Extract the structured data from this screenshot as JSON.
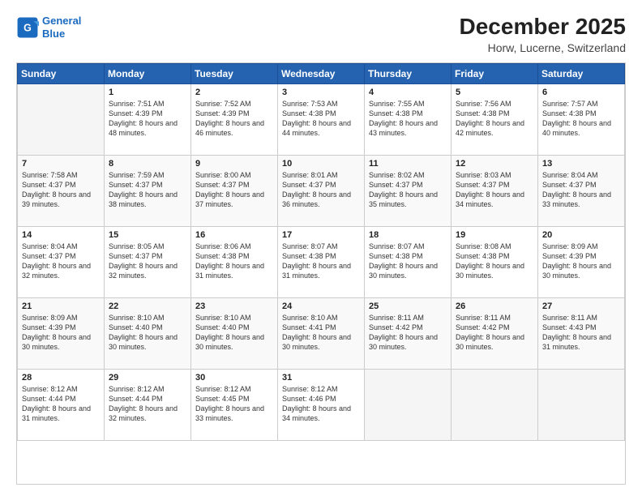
{
  "header": {
    "logo_line1": "General",
    "logo_line2": "Blue",
    "title": "December 2025",
    "subtitle": "Horw, Lucerne, Switzerland"
  },
  "weekdays": [
    "Sunday",
    "Monday",
    "Tuesday",
    "Wednesday",
    "Thursday",
    "Friday",
    "Saturday"
  ],
  "weeks": [
    [
      {
        "day": "",
        "sunrise": "",
        "sunset": "",
        "daylight": ""
      },
      {
        "day": "1",
        "sunrise": "Sunrise: 7:51 AM",
        "sunset": "Sunset: 4:39 PM",
        "daylight": "Daylight: 8 hours and 48 minutes."
      },
      {
        "day": "2",
        "sunrise": "Sunrise: 7:52 AM",
        "sunset": "Sunset: 4:39 PM",
        "daylight": "Daylight: 8 hours and 46 minutes."
      },
      {
        "day": "3",
        "sunrise": "Sunrise: 7:53 AM",
        "sunset": "Sunset: 4:38 PM",
        "daylight": "Daylight: 8 hours and 44 minutes."
      },
      {
        "day": "4",
        "sunrise": "Sunrise: 7:55 AM",
        "sunset": "Sunset: 4:38 PM",
        "daylight": "Daylight: 8 hours and 43 minutes."
      },
      {
        "day": "5",
        "sunrise": "Sunrise: 7:56 AM",
        "sunset": "Sunset: 4:38 PM",
        "daylight": "Daylight: 8 hours and 42 minutes."
      },
      {
        "day": "6",
        "sunrise": "Sunrise: 7:57 AM",
        "sunset": "Sunset: 4:38 PM",
        "daylight": "Daylight: 8 hours and 40 minutes."
      }
    ],
    [
      {
        "day": "7",
        "sunrise": "Sunrise: 7:58 AM",
        "sunset": "Sunset: 4:37 PM",
        "daylight": "Daylight: 8 hours and 39 minutes."
      },
      {
        "day": "8",
        "sunrise": "Sunrise: 7:59 AM",
        "sunset": "Sunset: 4:37 PM",
        "daylight": "Daylight: 8 hours and 38 minutes."
      },
      {
        "day": "9",
        "sunrise": "Sunrise: 8:00 AM",
        "sunset": "Sunset: 4:37 PM",
        "daylight": "Daylight: 8 hours and 37 minutes."
      },
      {
        "day": "10",
        "sunrise": "Sunrise: 8:01 AM",
        "sunset": "Sunset: 4:37 PM",
        "daylight": "Daylight: 8 hours and 36 minutes."
      },
      {
        "day": "11",
        "sunrise": "Sunrise: 8:02 AM",
        "sunset": "Sunset: 4:37 PM",
        "daylight": "Daylight: 8 hours and 35 minutes."
      },
      {
        "day": "12",
        "sunrise": "Sunrise: 8:03 AM",
        "sunset": "Sunset: 4:37 PM",
        "daylight": "Daylight: 8 hours and 34 minutes."
      },
      {
        "day": "13",
        "sunrise": "Sunrise: 8:04 AM",
        "sunset": "Sunset: 4:37 PM",
        "daylight": "Daylight: 8 hours and 33 minutes."
      }
    ],
    [
      {
        "day": "14",
        "sunrise": "Sunrise: 8:04 AM",
        "sunset": "Sunset: 4:37 PM",
        "daylight": "Daylight: 8 hours and 32 minutes."
      },
      {
        "day": "15",
        "sunrise": "Sunrise: 8:05 AM",
        "sunset": "Sunset: 4:37 PM",
        "daylight": "Daylight: 8 hours and 32 minutes."
      },
      {
        "day": "16",
        "sunrise": "Sunrise: 8:06 AM",
        "sunset": "Sunset: 4:38 PM",
        "daylight": "Daylight: 8 hours and 31 minutes."
      },
      {
        "day": "17",
        "sunrise": "Sunrise: 8:07 AM",
        "sunset": "Sunset: 4:38 PM",
        "daylight": "Daylight: 8 hours and 31 minutes."
      },
      {
        "day": "18",
        "sunrise": "Sunrise: 8:07 AM",
        "sunset": "Sunset: 4:38 PM",
        "daylight": "Daylight: 8 hours and 30 minutes."
      },
      {
        "day": "19",
        "sunrise": "Sunrise: 8:08 AM",
        "sunset": "Sunset: 4:38 PM",
        "daylight": "Daylight: 8 hours and 30 minutes."
      },
      {
        "day": "20",
        "sunrise": "Sunrise: 8:09 AM",
        "sunset": "Sunset: 4:39 PM",
        "daylight": "Daylight: 8 hours and 30 minutes."
      }
    ],
    [
      {
        "day": "21",
        "sunrise": "Sunrise: 8:09 AM",
        "sunset": "Sunset: 4:39 PM",
        "daylight": "Daylight: 8 hours and 30 minutes."
      },
      {
        "day": "22",
        "sunrise": "Sunrise: 8:10 AM",
        "sunset": "Sunset: 4:40 PM",
        "daylight": "Daylight: 8 hours and 30 minutes."
      },
      {
        "day": "23",
        "sunrise": "Sunrise: 8:10 AM",
        "sunset": "Sunset: 4:40 PM",
        "daylight": "Daylight: 8 hours and 30 minutes."
      },
      {
        "day": "24",
        "sunrise": "Sunrise: 8:10 AM",
        "sunset": "Sunset: 4:41 PM",
        "daylight": "Daylight: 8 hours and 30 minutes."
      },
      {
        "day": "25",
        "sunrise": "Sunrise: 8:11 AM",
        "sunset": "Sunset: 4:42 PM",
        "daylight": "Daylight: 8 hours and 30 minutes."
      },
      {
        "day": "26",
        "sunrise": "Sunrise: 8:11 AM",
        "sunset": "Sunset: 4:42 PM",
        "daylight": "Daylight: 8 hours and 30 minutes."
      },
      {
        "day": "27",
        "sunrise": "Sunrise: 8:11 AM",
        "sunset": "Sunset: 4:43 PM",
        "daylight": "Daylight: 8 hours and 31 minutes."
      }
    ],
    [
      {
        "day": "28",
        "sunrise": "Sunrise: 8:12 AM",
        "sunset": "Sunset: 4:44 PM",
        "daylight": "Daylight: 8 hours and 31 minutes."
      },
      {
        "day": "29",
        "sunrise": "Sunrise: 8:12 AM",
        "sunset": "Sunset: 4:44 PM",
        "daylight": "Daylight: 8 hours and 32 minutes."
      },
      {
        "day": "30",
        "sunrise": "Sunrise: 8:12 AM",
        "sunset": "Sunset: 4:45 PM",
        "daylight": "Daylight: 8 hours and 33 minutes."
      },
      {
        "day": "31",
        "sunrise": "Sunrise: 8:12 AM",
        "sunset": "Sunset: 4:46 PM",
        "daylight": "Daylight: 8 hours and 34 minutes."
      },
      {
        "day": "",
        "sunrise": "",
        "sunset": "",
        "daylight": ""
      },
      {
        "day": "",
        "sunrise": "",
        "sunset": "",
        "daylight": ""
      },
      {
        "day": "",
        "sunrise": "",
        "sunset": "",
        "daylight": ""
      }
    ]
  ]
}
